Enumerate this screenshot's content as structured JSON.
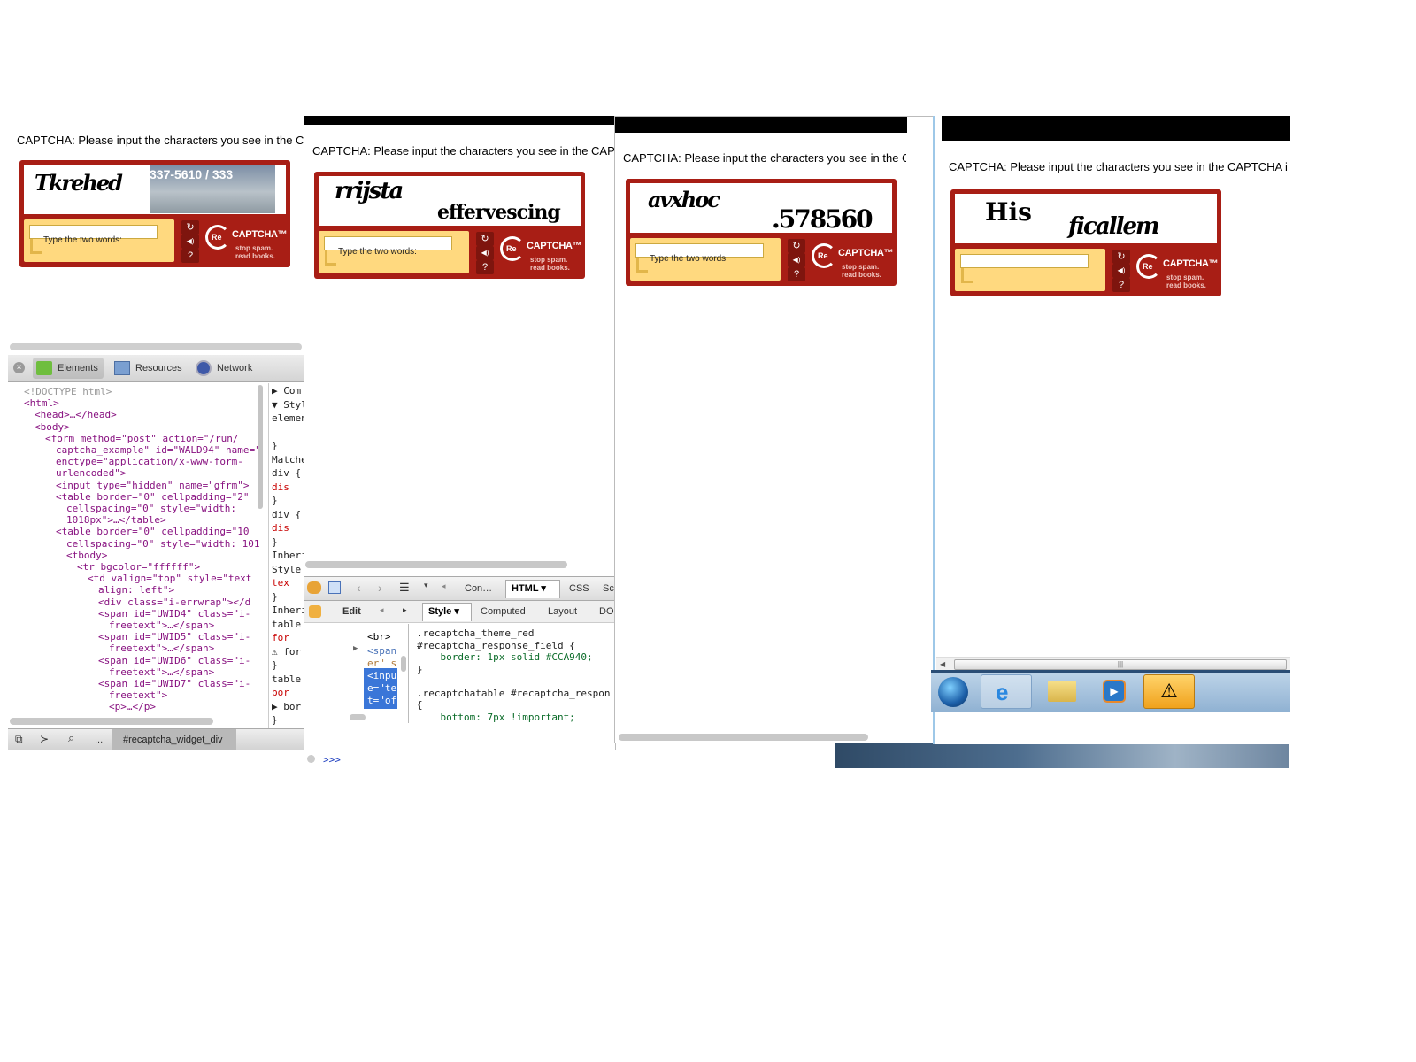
{
  "prompt_text": "CAPTCHA: Please input the characters you see in the CAPTCHA i",
  "captcha": {
    "hint": "Type the two words:",
    "brand": "CAPTCHA™",
    "brand_prefix": "Re",
    "tagline_1": "stop spam.",
    "tagline_2": "read books.",
    "controls": [
      "↻",
      "◀)",
      "?"
    ]
  },
  "windows": [
    {
      "word1": "Tkrehed",
      "word2": "337-5610 / 333"
    },
    {
      "word1": "rrijsta",
      "word2": "effervescing"
    },
    {
      "word1": "avxhoc",
      "word2": ".578560"
    },
    {
      "word1": "His",
      "word2": "ficallem"
    }
  ],
  "devtools_left": {
    "tabs": [
      "Elements",
      "Resources",
      "Network"
    ],
    "dom_lines": [
      {
        "text": "<!DOCTYPE html>",
        "indent": 0
      },
      {
        "text": "<html>",
        "indent": 0
      },
      {
        "text": "<head>…</head>",
        "indent": 1
      },
      {
        "text": "<body>",
        "indent": 1
      },
      {
        "text": "<form method=\"post\" action=\"/run/",
        "indent": 2
      },
      {
        "text": "captcha_example\" id=\"WALD94\" name=\"",
        "indent": 3
      },
      {
        "text": "enctype=\"application/x-www-form-",
        "indent": 3
      },
      {
        "text": "urlencoded\">",
        "indent": 3
      },
      {
        "text": "<input type=\"hidden\" name=\"gfrm\">",
        "indent": 3
      },
      {
        "text": "<table border=\"0\" cellpadding=\"2\"",
        "indent": 3
      },
      {
        "text": "cellspacing=\"0\" style=\"width:",
        "indent": 4
      },
      {
        "text": "1018px\">…</table>",
        "indent": 4
      },
      {
        "text": "<table border=\"0\" cellpadding=\"10",
        "indent": 3
      },
      {
        "text": "cellspacing=\"0\" style=\"width: 101",
        "indent": 4
      },
      {
        "text": "<tbody>",
        "indent": 4
      },
      {
        "text": "<tr bgcolor=\"ffffff\">",
        "indent": 5
      },
      {
        "text": "<td valign=\"top\" style=\"text",
        "indent": 6
      },
      {
        "text": "align: left\">",
        "indent": 7
      },
      {
        "text": "<div class=\"i-errwrap\"></d",
        "indent": 7
      },
      {
        "text": "<span id=\"UWID4\" class=\"i-",
        "indent": 7
      },
      {
        "text": "freetext\">…</span>",
        "indent": 8
      },
      {
        "text": "<span id=\"UWID5\" class=\"i-",
        "indent": 7
      },
      {
        "text": "freetext\">…</span>",
        "indent": 8
      },
      {
        "text": "<span id=\"UWID6\" class=\"i-",
        "indent": 7
      },
      {
        "text": "freetext\">…</span>",
        "indent": 8
      },
      {
        "text": "<span id=\"UWID7\" class=\"i-",
        "indent": 7
      },
      {
        "text": "freetext\">",
        "indent": 8
      },
      {
        "text": "<p>…</p>",
        "indent": 8
      }
    ],
    "side_lines": [
      "▶ Com",
      "▼ Styl",
      "elemen",
      "",
      "}",
      "Matche",
      "div {",
      "  dis",
      "}",
      "div {",
      "  dis",
      "}",
      "Inherit",
      "Style",
      "  tex",
      "}",
      "Inherit",
      "table",
      "  for",
      "⚠ for",
      "}",
      "table",
      "  bor",
      "▶ bor",
      "}"
    ],
    "breadcrumb": "#recaptcha_widget_div",
    "ellipsis": "..."
  },
  "firebug": {
    "tabs": [
      "Con…",
      "HTML ▾",
      "CSS",
      "Sc"
    ],
    "subtabs": [
      "Style ▾",
      "Computed",
      "Layout",
      "DO"
    ],
    "edit": "Edit",
    "tree": [
      "<br>",
      "<span",
      "er\" s",
      "<inpu",
      "e=\"te",
      "t=\"of"
    ],
    "css_lines": [
      ".recaptcha_theme_red",
      "#recaptcha_response_field {",
      "    border: 1px solid #CCA940;",
      "}",
      "",
      ".recaptchatable #recaptcha_respon",
      "{",
      "    bottom: 7px !important;"
    ],
    "console_prompt": ">>>"
  },
  "taskbar": {
    "icons": [
      "start-orb",
      "internet-explorer",
      "folder",
      "media-player",
      "warning"
    ]
  },
  "colors": {
    "captcha_red": "#a81e15",
    "answer_yellow": "#ffd97f",
    "selection_blue": "#3a76d8"
  }
}
